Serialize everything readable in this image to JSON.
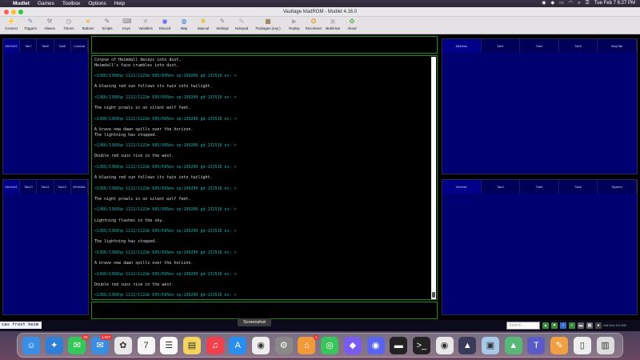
{
  "menubar": {
    "apple": "",
    "items": [
      "Mudlet",
      "Games",
      "Toolbox",
      "Options",
      "Help"
    ],
    "clock": "Tue Feb 7  6:27 PM"
  },
  "window": {
    "title": "Vaultage MadROM - Mudlet 4.16.0"
  },
  "toolbar": {
    "buttons": [
      {
        "label": "Connect",
        "icon": "plug-icon",
        "glyph": "⚡",
        "color": "#e8a33a"
      },
      {
        "label": "Triggers",
        "icon": "trigger-icon",
        "glyph": "✎",
        "color": "#6a86c8"
      },
      {
        "label": "Aliases",
        "icon": "alias-icon",
        "glyph": "⚒",
        "color": "#8b8b8b"
      },
      {
        "label": "Timers",
        "icon": "clock-icon",
        "glyph": "◷",
        "color": "#999"
      },
      {
        "label": "Buttons",
        "icon": "star-icon",
        "glyph": "★",
        "color": "#e8b83a"
      },
      {
        "label": "Scripts",
        "icon": "script-icon",
        "glyph": "✎",
        "color": "#7a7a7a"
      },
      {
        "label": "Keys",
        "icon": "key-icon",
        "glyph": "⌨",
        "color": "#888"
      },
      {
        "label": "Variables",
        "icon": "variables-icon",
        "glyph": "✕",
        "color": "#9a9a9a"
      },
      {
        "label": "Discord",
        "icon": "discord-icon",
        "glyph": "◉",
        "color": "#5865f2"
      },
      {
        "label": "Map",
        "icon": "globe-icon",
        "glyph": "◍",
        "color": "#3a7ad8"
      },
      {
        "label": "Manual",
        "icon": "lightbulb-icon",
        "glyph": "✺",
        "color": "#e8c23a"
      },
      {
        "label": "Settings",
        "icon": "settings-icon",
        "glyph": "✎",
        "color": "#888"
      },
      {
        "label": "Notepad",
        "icon": "notepad-icon",
        "glyph": "✎",
        "color": "#aaa"
      },
      {
        "label": "Packages (exp.)",
        "icon": "package-icon",
        "glyph": "▦",
        "color": "#8a6a3a"
      },
      {
        "label": "Replay",
        "icon": "replay-icon",
        "glyph": "▶",
        "color": "#aaa"
      },
      {
        "label": "Reconnect",
        "icon": "reconnect-icon",
        "glyph": "✪",
        "color": "#e8a33a"
      },
      {
        "label": "MultiView",
        "icon": "multiview-icon",
        "glyph": "▣",
        "color": "#bbb"
      },
      {
        "label": "About",
        "icon": "about-icon",
        "glyph": "✿",
        "color": "#58a858"
      }
    ]
  },
  "panels": {
    "top_left_tabs": [
      "MsTeW1",
      "Tab7",
      "Tab8",
      "Tab9",
      "Combat"
    ],
    "bottom_left_tabs": [
      "MsTeW1",
      "Tab10",
      "Tab11",
      "Tab12",
      "WHAMA"
    ],
    "top_right_tabs": [
      "MsDesk",
      "Tab1",
      "Tab2",
      "Tab3",
      "MapTab"
    ],
    "bottom_right_tabs": [
      "MsTeW",
      "Tab4",
      "Tab5",
      "Tab6",
      "System"
    ]
  },
  "console": {
    "lines": [
      {
        "t": "Corpse of Heimdall decays into dust.",
        "p": false
      },
      {
        "t": "Heimdall's face crumbles into dust.",
        "p": false
      },
      {
        "t": "",
        "p": false
      },
      {
        "t": "<1366/1366hp 1122/1122m 695/695mv xp:109200 gd:131516 ex: >",
        "p": true
      },
      {
        "t": "",
        "p": false
      },
      {
        "t": "A blazing red sun follows its twin into twilight.",
        "p": false
      },
      {
        "t": "",
        "p": false
      },
      {
        "t": "<1366/1366hp 1122/1122m 695/695mv xp:109200 gd:131516 ex: >",
        "p": true
      },
      {
        "t": "",
        "p": false
      },
      {
        "t": "The night prowls in on silent wolf feet.",
        "p": false
      },
      {
        "t": "",
        "p": false
      },
      {
        "t": "<1366/1366hp 1122/1122m 695/695mv xp:109200 gd:131516 ex: >",
        "p": true
      },
      {
        "t": "",
        "p": false
      },
      {
        "t": "A brave new dawn spills over the horizon.",
        "p": false
      },
      {
        "t": "The lightning has stopped.",
        "p": false
      },
      {
        "t": "",
        "p": false
      },
      {
        "t": "<1366/1366hp 1122/1122m 695/695mv xp:109200 gd:131516 ex: >",
        "p": true
      },
      {
        "t": "",
        "p": false
      },
      {
        "t": "Double red suns rise in the west.",
        "p": false
      },
      {
        "t": "",
        "p": false
      },
      {
        "t": "<1366/1366hp 1122/1122m 695/695mv xp:109200 gd:131516 ex: >",
        "p": true
      },
      {
        "t": "",
        "p": false
      },
      {
        "t": "A blazing red sun follows its twin into twilight.",
        "p": false
      },
      {
        "t": "",
        "p": false
      },
      {
        "t": "<1366/1366hp 1122/1122m 695/695mv xp:109200 gd:131516 ex: >",
        "p": true
      },
      {
        "t": "",
        "p": false
      },
      {
        "t": "The night prowls in on silent wolf feet.",
        "p": false
      },
      {
        "t": "",
        "p": false
      },
      {
        "t": "<1366/1366hp 1122/1122m 695/695mv xp:109200 gd:131516 ex: >",
        "p": true
      },
      {
        "t": "",
        "p": false
      },
      {
        "t": "Lightning flashes in the sky.",
        "p": false
      },
      {
        "t": "",
        "p": false
      },
      {
        "t": "<1366/1366hp 1122/1122m 695/695mv xp:109200 gd:131516 ex: >",
        "p": true
      },
      {
        "t": "",
        "p": false
      },
      {
        "t": "The lightning has stopped.",
        "p": false
      },
      {
        "t": "",
        "p": false
      },
      {
        "t": "<1366/1366hp 1122/1122m 695/695mv xp:109200 gd:131516 ex: >",
        "p": true
      },
      {
        "t": "",
        "p": false
      },
      {
        "t": "A brave new dawn spills over the horizon.",
        "p": false
      },
      {
        "t": "",
        "p": false
      },
      {
        "t": "<1366/1366hp 1122/1122m 695/695mv xp:109200 gd:131516 ex: >",
        "p": true
      },
      {
        "t": "",
        "p": false
      },
      {
        "t": "Double red suns rise in the west.",
        "p": false
      },
      {
        "t": "",
        "p": false
      },
      {
        "t": "<1366/1366hp 1122/1122m 695/695mv xp:109200 gd:131516 ex: >",
        "p": true
      }
    ]
  },
  "command": {
    "value": "cas frost heim",
    "search_placeholder": "Search ...",
    "version": "Vtd Gdv 5.0.000"
  },
  "tooltip": "Screenshot",
  "dock": {
    "apps": [
      {
        "name": "finder",
        "glyph": "☺",
        "color": "#3a8ee8"
      },
      {
        "name": "safari",
        "glyph": "✦",
        "color": "#2f7fd8"
      },
      {
        "name": "messages",
        "glyph": "✉",
        "color": "#35c759",
        "badge": "20"
      },
      {
        "name": "mail",
        "glyph": "✉",
        "color": "#3c8ce0",
        "badge": "1,927"
      },
      {
        "name": "photos",
        "glyph": "✿",
        "color": "#e8e8e8"
      },
      {
        "name": "calendar",
        "glyph": "7",
        "color": "#f6f6f6"
      },
      {
        "name": "reminders",
        "glyph": "☰",
        "color": "#fafafa"
      },
      {
        "name": "notes",
        "glyph": "▤",
        "color": "#f4d35e"
      },
      {
        "name": "music",
        "glyph": "♫",
        "color": "#f2404e"
      },
      {
        "name": "app-store",
        "glyph": "A",
        "color": "#2a8ef0"
      },
      {
        "name": "screenshot",
        "glyph": "◉",
        "color": "#eee"
      },
      {
        "name": "system-settings",
        "glyph": "⚙",
        "color": "#888"
      },
      {
        "name": "home",
        "glyph": "⌂",
        "color": "#f29a3a",
        "badge": "1"
      },
      {
        "name": "find-my",
        "glyph": "◎",
        "color": "#3ac45a"
      },
      {
        "name": "shortcuts",
        "glyph": "◆",
        "color": "#7a5af0"
      },
      {
        "name": "discord",
        "glyph": "◉",
        "color": "#5865f2"
      },
      {
        "name": "mudlet",
        "glyph": "▬",
        "color": "#222"
      },
      {
        "name": "terminal",
        "glyph": ">_",
        "color": "#222"
      },
      {
        "name": "chrome",
        "glyph": "◉",
        "color": "#e8e8e8"
      },
      {
        "name": "stacks",
        "glyph": "▲",
        "color": "#3a3a5a"
      },
      {
        "name": "preview",
        "glyph": "▣",
        "color": "#a8c8e8"
      },
      {
        "name": "macos-installer",
        "glyph": "▲",
        "color": "#58b878"
      },
      {
        "name": "teams",
        "glyph": "T",
        "color": "#5a5ac8"
      },
      {
        "name": "pages",
        "glyph": "✎",
        "color": "#f0a040"
      },
      {
        "name": "documents",
        "glyph": "▯",
        "color": "#eee"
      },
      {
        "name": "trash",
        "glyph": "▥",
        "color": "#ddd"
      }
    ]
  }
}
